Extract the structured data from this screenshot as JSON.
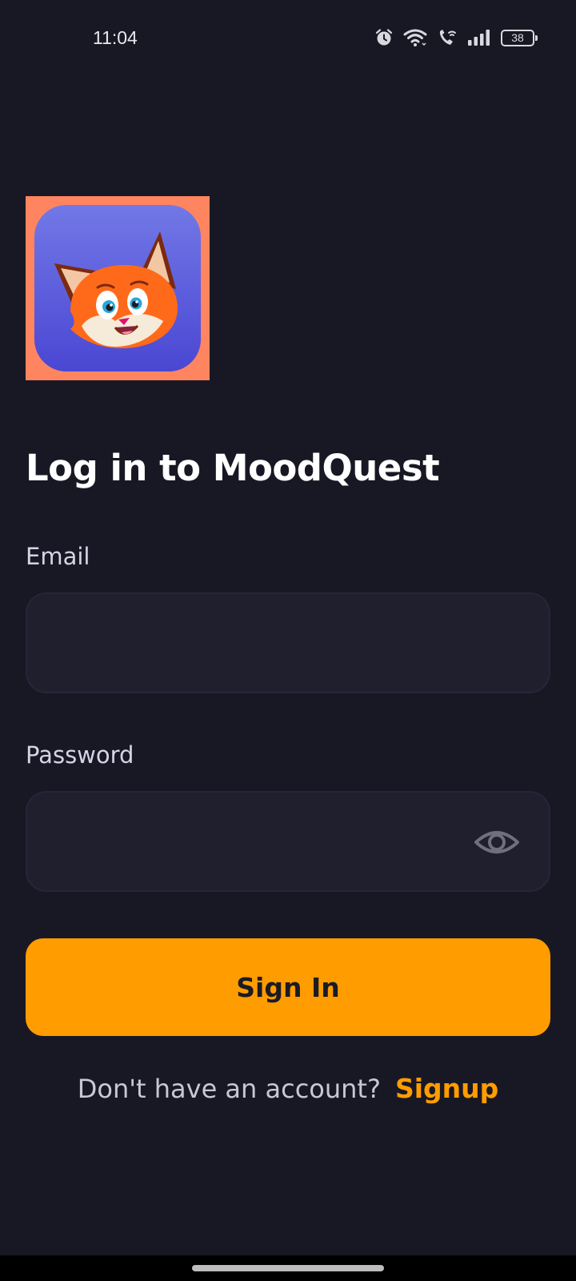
{
  "status_bar": {
    "time": "11:04",
    "battery": "38",
    "icons": [
      "alarm-icon",
      "wifi-icon",
      "wifi-calling-icon",
      "signal-icon",
      "battery-icon"
    ]
  },
  "logo": {
    "icon": "fox-mascot-icon",
    "background_color": "#ff8561",
    "tile_color": "#5c5fe0"
  },
  "title": "Log in to MoodQuest",
  "email": {
    "label": "Email",
    "value": "",
    "placeholder": ""
  },
  "password": {
    "label": "Password",
    "value": "",
    "placeholder": "",
    "toggle_icon": "eye-icon"
  },
  "signin_button": {
    "label": "Sign In"
  },
  "signup": {
    "prompt": "Don't have an account?",
    "link": "Signup"
  },
  "colors": {
    "background": "#181824",
    "input_background": "#1f1f2e",
    "accent": "#ff9c00",
    "text": "#ffffff",
    "muted_text": "#c9c6d6"
  }
}
